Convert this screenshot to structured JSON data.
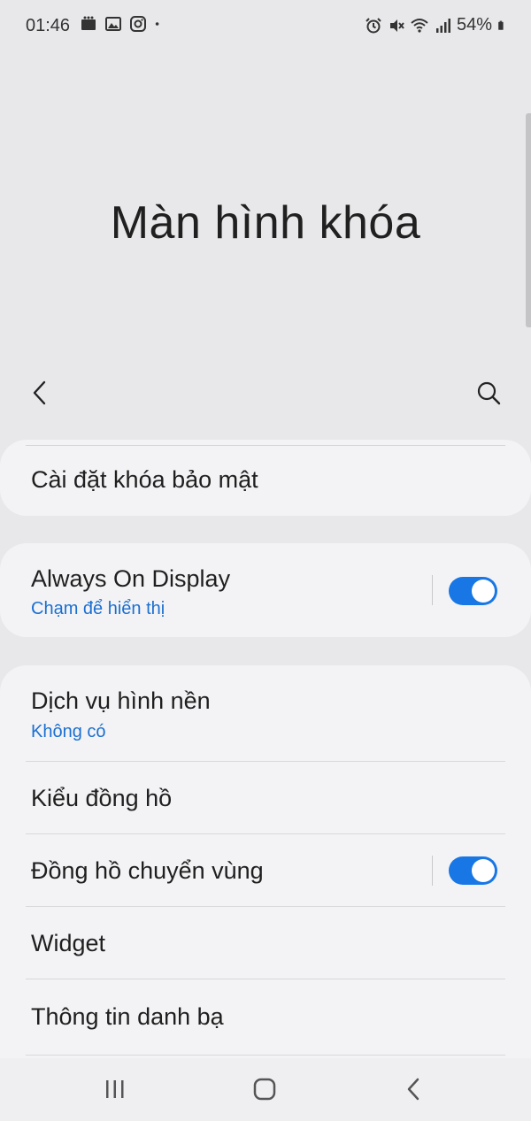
{
  "status_bar": {
    "time": "01:46",
    "left_icons": [
      "notification-icon",
      "gallery-icon",
      "instagram-icon",
      "dot-icon"
    ],
    "right_icons": [
      "alarm-icon",
      "mute-icon",
      "wifi-icon",
      "signal-icon"
    ],
    "battery": "54%"
  },
  "page": {
    "title": "Màn hình khóa"
  },
  "cards": {
    "security": {
      "title": "Cài đặt khóa bảo mật"
    },
    "aod": {
      "title": "Always On Display",
      "subtitle": "Chạm để hiển thị",
      "toggle_on": true
    },
    "main": {
      "wallpaper_title": "Dịch vụ hình nền",
      "wallpaper_sub": "Không có",
      "clock_style": "Kiểu đồng hồ",
      "roaming_clock": "Đồng hồ chuyển vùng",
      "roaming_on": true,
      "widget": "Widget",
      "contact_info": "Thông tin danh bạ"
    }
  },
  "colors": {
    "accent": "#1877e5",
    "subtitle": "#1b6fd1",
    "background": "#e8e8ea",
    "card": "#f3f3f5"
  }
}
